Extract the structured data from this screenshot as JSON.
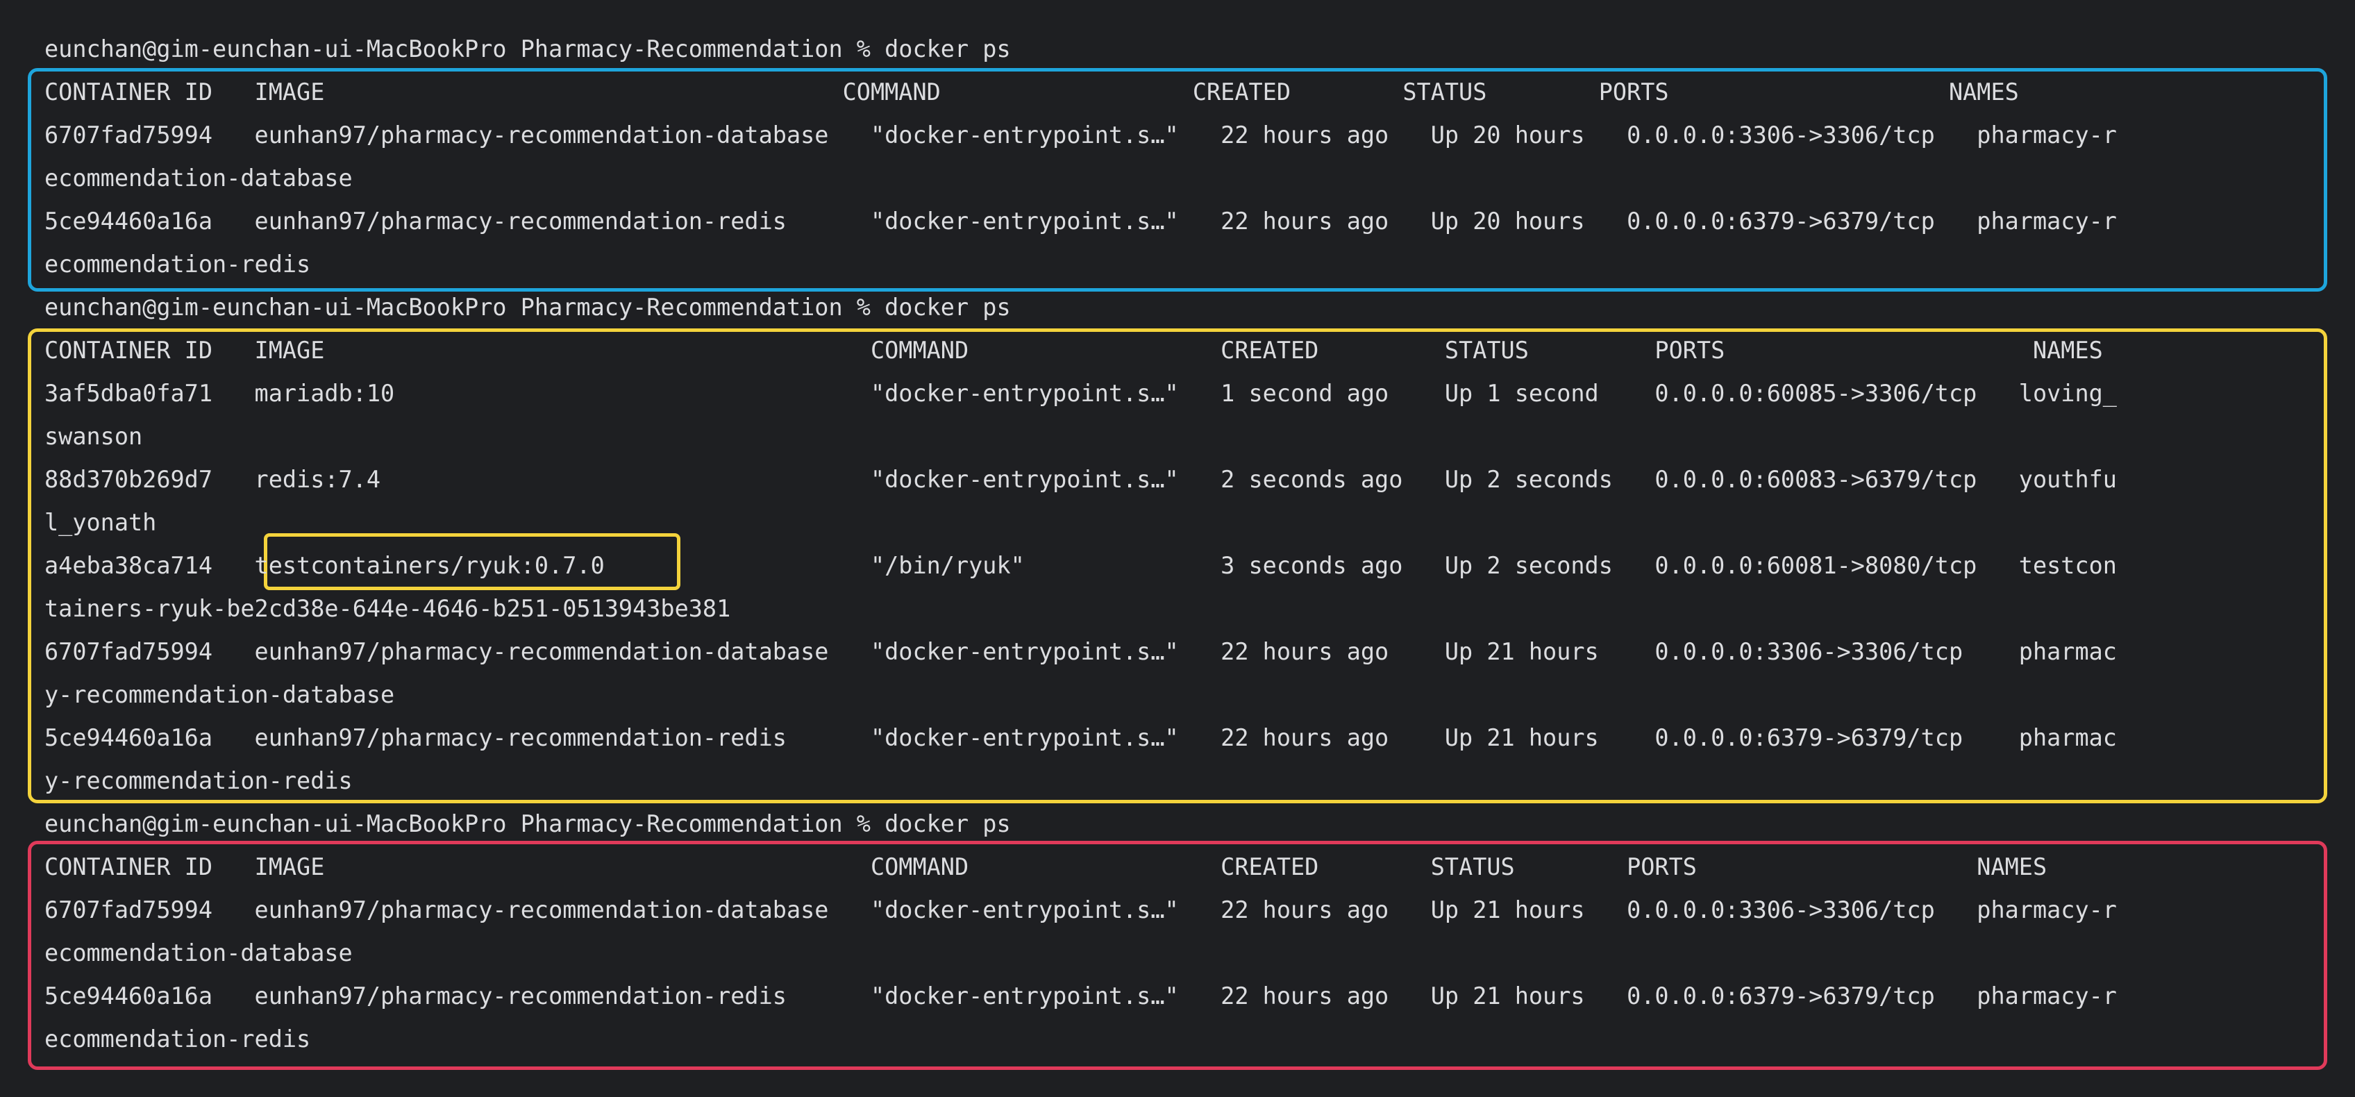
{
  "colors": {
    "background": "#1e1f22",
    "text": "#dcdde0",
    "box1": "#1ea5dc",
    "box2": "#f4d33c",
    "box3": "#e03a5a"
  },
  "lines": [
    "eunchan@gim-eunchan-ui-MacBookPro Pharmacy-Recommendation % docker ps",
    "CONTAINER ID   IMAGE                                     COMMAND                  CREATED        STATUS        PORTS                    NAMES",
    "6707fad75994   eunhan97/pharmacy-recommendation-database   \"docker-entrypoint.s…\"   22 hours ago   Up 20 hours   0.0.0.0:3306->3306/tcp   pharmacy-r",
    "ecommendation-database",
    "5ce94460a16a   eunhan97/pharmacy-recommendation-redis      \"docker-entrypoint.s…\"   22 hours ago   Up 20 hours   0.0.0.0:6379->6379/tcp   pharmacy-r",
    "ecommendation-redis",
    "eunchan@gim-eunchan-ui-MacBookPro Pharmacy-Recommendation % docker ps",
    "CONTAINER ID   IMAGE                                       COMMAND                  CREATED         STATUS         PORTS                      NAMES",
    "3af5dba0fa71   mariadb:10                                  \"docker-entrypoint.s…\"   1 second ago    Up 1 second    0.0.0.0:60085->3306/tcp   loving_",
    "swanson",
    "88d370b269d7   redis:7.4                                   \"docker-entrypoint.s…\"   2 seconds ago   Up 2 seconds   0.0.0.0:60083->6379/tcp   youthfu",
    "l_yonath",
    "a4eba38ca714   testcontainers/ryuk:0.7.0                   \"/bin/ryuk\"              3 seconds ago   Up 2 seconds   0.0.0.0:60081->8080/tcp   testcon",
    "tainers-ryuk-be2cd38e-644e-4646-b251-0513943be381",
    "6707fad75994   eunhan97/pharmacy-recommendation-database   \"docker-entrypoint.s…\"   22 hours ago    Up 21 hours    0.0.0.0:3306->3306/tcp    pharmac",
    "y-recommendation-database",
    "5ce94460a16a   eunhan97/pharmacy-recommendation-redis      \"docker-entrypoint.s…\"   22 hours ago    Up 21 hours    0.0.0.0:6379->6379/tcp    pharmac",
    "y-recommendation-redis",
    "eunchan@gim-eunchan-ui-MacBookPro Pharmacy-Recommendation % docker ps",
    "CONTAINER ID   IMAGE                                       COMMAND                  CREATED        STATUS        PORTS                    NAMES",
    "6707fad75994   eunhan97/pharmacy-recommendation-database   \"docker-entrypoint.s…\"   22 hours ago   Up 21 hours   0.0.0.0:3306->3306/tcp   pharmacy-r",
    "ecommendation-database",
    "5ce94460a16a   eunhan97/pharmacy-recommendation-redis      \"docker-entrypoint.s…\"   22 hours ago   Up 21 hours   0.0.0.0:6379->6379/tcp   pharmacy-r",
    "ecommendation-redis"
  ]
}
